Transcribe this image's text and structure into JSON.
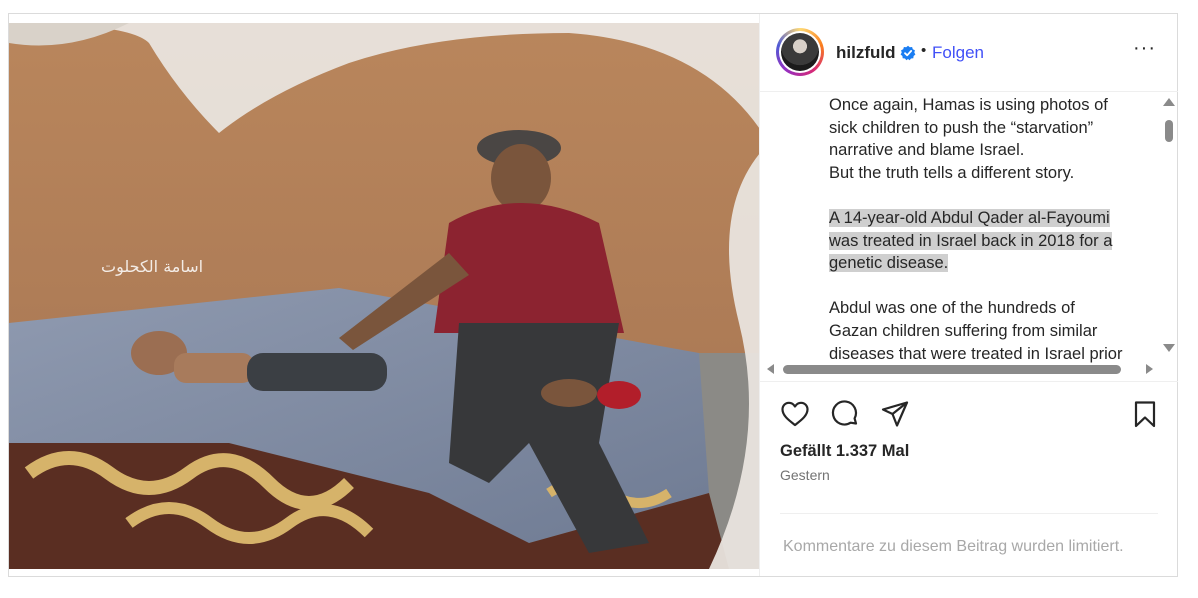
{
  "photo": {
    "watermark": "اسامة الكحلوت"
  },
  "header": {
    "username": "hilzfuld",
    "separator": "•",
    "follow_label": "Folgen",
    "more_label": "···"
  },
  "caption": {
    "paragraph_1": [
      "Once again, Hamas is using photos of",
      "sick children to push the “starvation”",
      "narrative and blame Israel.",
      "But the truth tells a different story."
    ],
    "paragraph_2": [
      "A 14-year-old Abdul Qader al-Fayoumi",
      "was treated in Israel back in 2018 for a",
      "genetic disease."
    ],
    "paragraph_3": [
      "Abdul was one of the hundreds of",
      "Gazan children suffering from similar",
      "diseases that were treated in Israel prior"
    ]
  },
  "actions": {
    "like_icon": "heart-icon",
    "comment_icon": "comment-icon",
    "share_icon": "share-icon",
    "save_icon": "bookmark-icon"
  },
  "likes_text": "Gefällt 1.337 Mal",
  "date_text": "Gestern",
  "comments_limited_text": "Kommentare zu diesem Beitrag wurden limitiert.",
  "colors": {
    "follow_blue": "#4150f7",
    "verified_blue": "#1a7df2",
    "highlight": "#cfcfcf",
    "muted": "#737373"
  }
}
